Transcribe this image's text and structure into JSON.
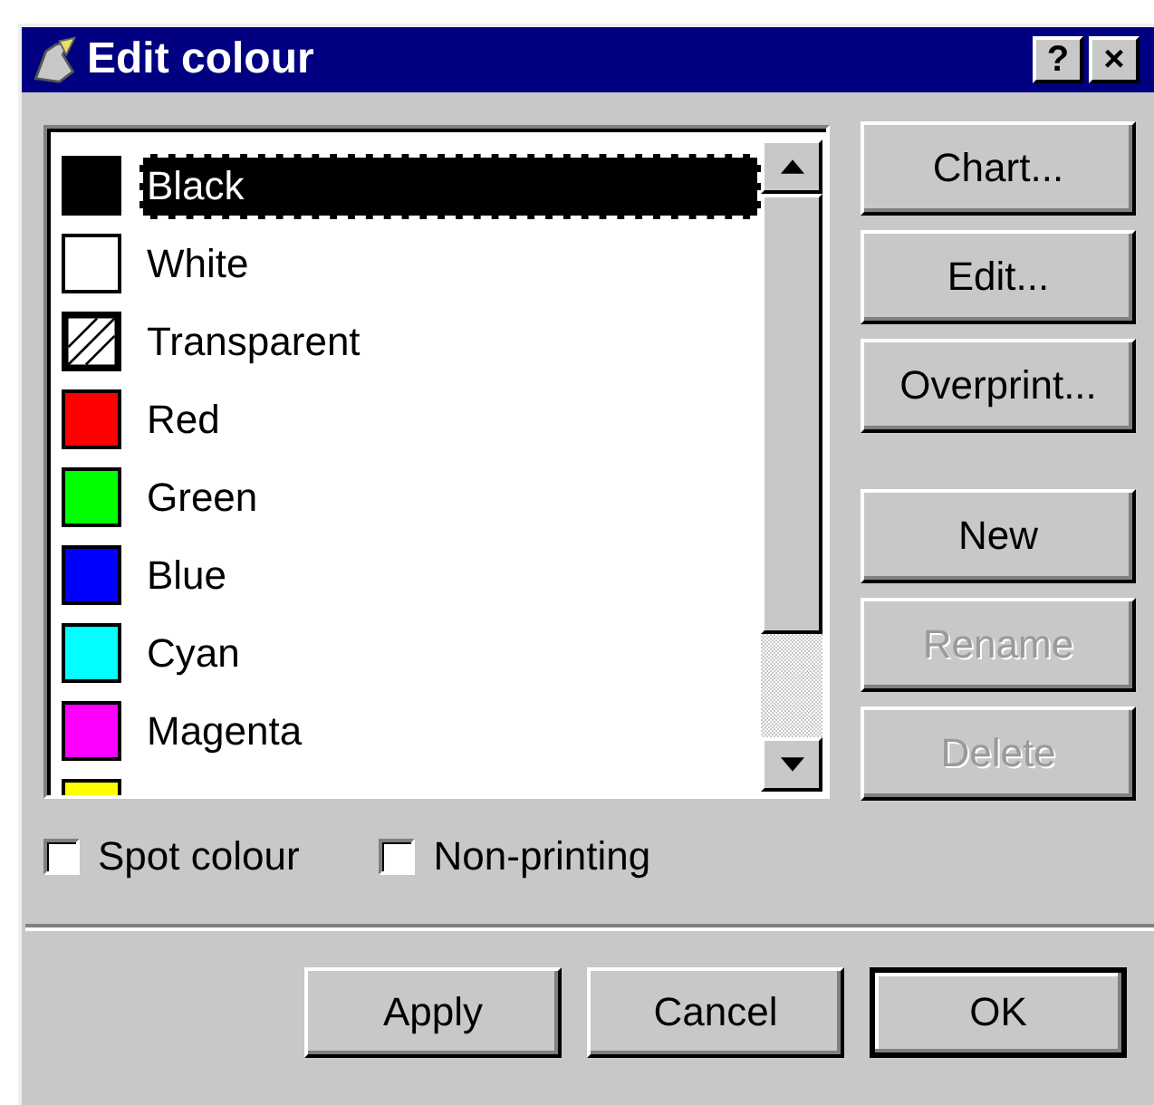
{
  "window": {
    "title": "Edit colour",
    "help_button": "?",
    "close_button": "×"
  },
  "colours": [
    {
      "name": "Black",
      "kind": "solid",
      "color": "#000000",
      "selected": true
    },
    {
      "name": "White",
      "kind": "solid",
      "color": "#ffffff",
      "selected": false
    },
    {
      "name": "Transparent",
      "kind": "transparent",
      "selected": false
    },
    {
      "name": "Red",
      "kind": "solid",
      "color": "#ff0000",
      "selected": false
    },
    {
      "name": "Green",
      "kind": "solid",
      "color": "#00ff00",
      "selected": false
    },
    {
      "name": "Blue",
      "kind": "solid",
      "color": "#0000ff",
      "selected": false
    },
    {
      "name": "Cyan",
      "kind": "solid",
      "color": "#00ffff",
      "selected": false
    },
    {
      "name": "Magenta",
      "kind": "solid",
      "color": "#ff00ff",
      "selected": false
    },
    {
      "kind": "solid",
      "color": "#ffff00"
    }
  ],
  "side_button_groups": [
    {
      "buttons": [
        {
          "label": "Chart...",
          "disabled": false
        },
        {
          "label": "Edit...",
          "disabled": false
        },
        {
          "label": "Overprint...",
          "disabled": false
        }
      ]
    },
    {
      "buttons": [
        {
          "label": "New",
          "disabled": false
        },
        {
          "label": "Rename",
          "disabled": true
        },
        {
          "label": "Delete",
          "disabled": true
        }
      ]
    }
  ],
  "options": [
    {
      "label": "Spot colour",
      "checked": false
    },
    {
      "label": "Non-printing",
      "checked": false
    }
  ],
  "buttons": [
    {
      "label": "Apply",
      "default": false
    },
    {
      "label": "Cancel",
      "default": false
    },
    {
      "label": "OK",
      "default": true
    }
  ]
}
